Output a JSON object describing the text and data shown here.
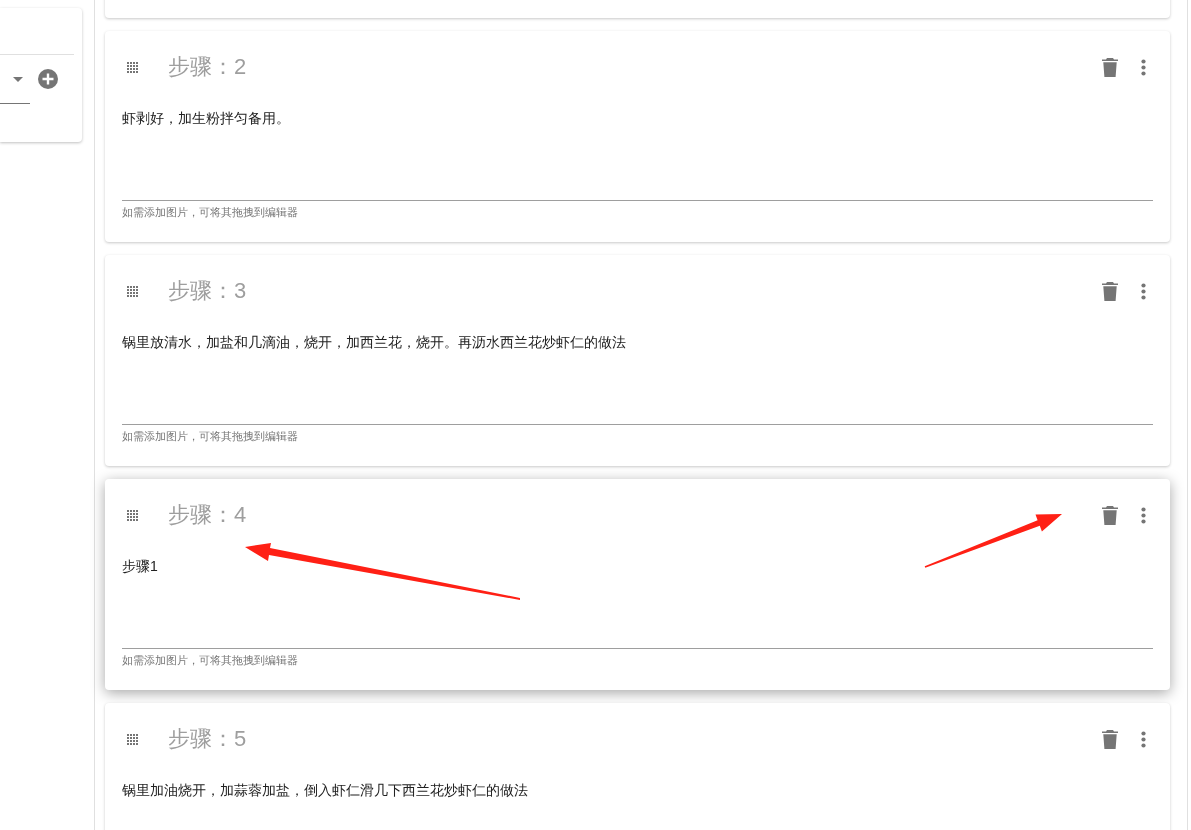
{
  "steps": [
    {
      "title": "步骤：2",
      "text": "虾剥好，加生粉拌匀备用。",
      "hint": "如需添加图片，可将其拖拽到编辑器",
      "raised": false
    },
    {
      "title": "步骤：3",
      "text": "锅里放清水，加盐和几滴油，烧开，加西兰花，烧开。再沥水西兰花炒虾仁的做法",
      "hint": "如需添加图片，可将其拖拽到编辑器",
      "raised": false
    },
    {
      "title": "步骤：4",
      "text": "步骤1",
      "hint": "如需添加图片，可将其拖拽到编辑器",
      "raised": true
    },
    {
      "title": "步骤：5",
      "text": "锅里加油烧开，加蒜蓉加盐，倒入虾仁滑几下西兰花炒虾仁的做法",
      "raised": false
    }
  ]
}
